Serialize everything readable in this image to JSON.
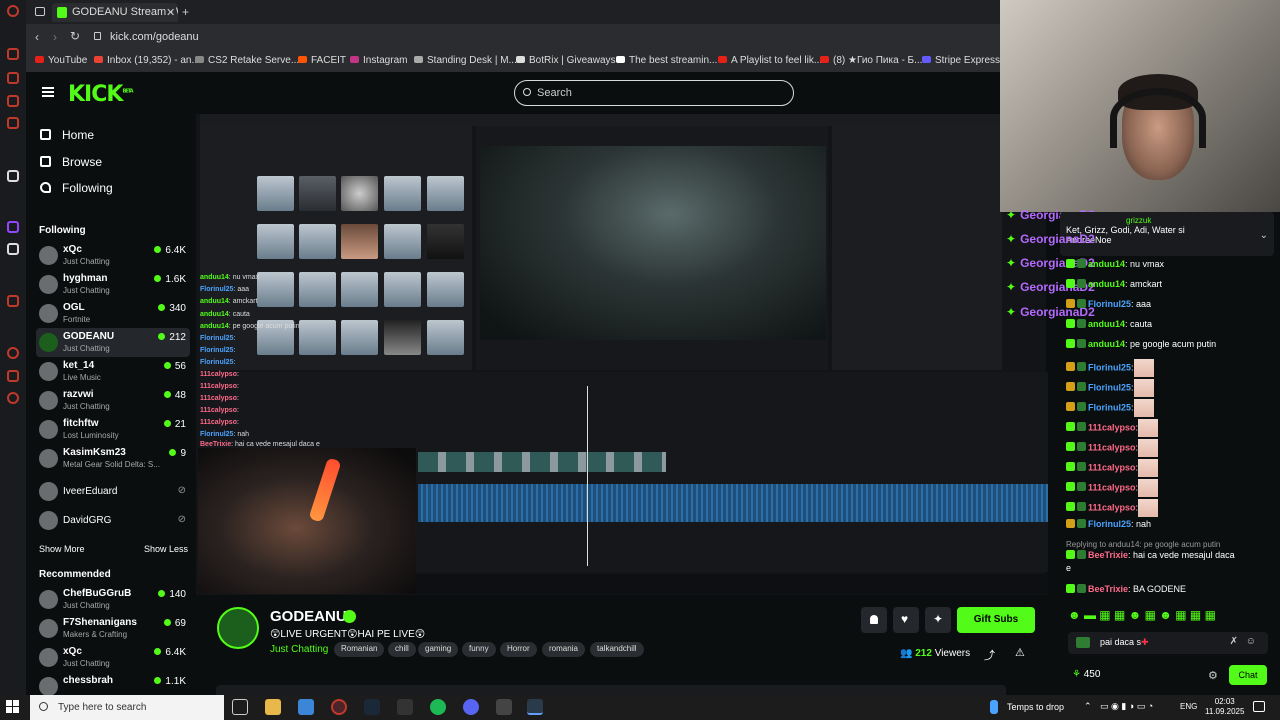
{
  "browser": {
    "tab_title": "GODEANU Stream - Watc",
    "url": "kick.com/godeanu",
    "bookmarks": [
      "YouTube",
      "Inbox (19,352) - an...",
      "CS2 Retake Serve...",
      "FACEIT",
      "Instagram",
      "Standing Desk | M...",
      "BotRix | Giveaways",
      "The best streamin...",
      "A Playlist to feel lik...",
      "(8) ★Гио Пика - Б...",
      "Stripe Express"
    ]
  },
  "header": {
    "logo": "KICK",
    "logo_beta": "BETA",
    "search_placeholder": "Search"
  },
  "nav": {
    "home": "Home",
    "browse": "Browse",
    "following": "Following"
  },
  "sidebar": {
    "following_title": "Following",
    "following": [
      {
        "name": "xQc",
        "sub": "Just Chatting",
        "count": "6.4K"
      },
      {
        "name": "hyghman",
        "sub": "Just Chatting",
        "count": "1.6K"
      },
      {
        "name": "OGL",
        "sub": "Fortnite",
        "count": "340"
      },
      {
        "name": "GODEANU",
        "sub": "Just Chatting",
        "count": "212"
      },
      {
        "name": "ket_14",
        "sub": "Live Music",
        "count": "56"
      },
      {
        "name": "razvwi",
        "sub": "Just Chatting",
        "count": "48"
      },
      {
        "name": "fitchftw",
        "sub": "Lost Luminosity",
        "count": "21"
      },
      {
        "name": "KasimKsm23",
        "sub": "Metal Gear Solid Delta: S...",
        "count": "9"
      },
      {
        "name": "IveerEduard",
        "sub": "",
        "count": ""
      },
      {
        "name": "DavidGRG",
        "sub": "",
        "count": ""
      }
    ],
    "show_more": "Show More",
    "show_less": "Show Less",
    "recommended_title": "Recommended",
    "recommended": [
      {
        "name": "ChefBuGGruB",
        "sub": "Just Chatting",
        "count": "140"
      },
      {
        "name": "F7Shenanigans",
        "sub": "Makers & Crafting",
        "count": "69"
      },
      {
        "name": "xQc",
        "sub": "Just Chatting",
        "count": "6.4K"
      },
      {
        "name": "chessbrah",
        "sub": "",
        "count": "1.1K"
      }
    ]
  },
  "video_chat": [
    {
      "user": "anduu14",
      "text": "nu vmax"
    },
    {
      "user": "Florinul25",
      "text": "aaa"
    },
    {
      "user": "anduu14",
      "text": "amckart"
    },
    {
      "user": "anduu14",
      "text": "cauta"
    },
    {
      "user": "anduu14",
      "text": "pe google acum putin"
    },
    {
      "user": "Florinul25",
      "text": ""
    },
    {
      "user": "Florinul25",
      "text": ""
    },
    {
      "user": "Florinul25",
      "text": ""
    },
    {
      "user": "111calypso",
      "text": ""
    },
    {
      "user": "111calypso",
      "text": ""
    },
    {
      "user": "111calypso",
      "text": ""
    },
    {
      "user": "111calypso",
      "text": ""
    },
    {
      "user": "111calypso",
      "text": ""
    },
    {
      "user": "Florinul25",
      "text": "nah"
    },
    {
      "user": "BeeTrixie",
      "text": "hai ca vede mesajul daca e"
    }
  ],
  "stream": {
    "name": "GODEANU",
    "title": "😲LIVE URGENT😲HAI PE LIVE😲",
    "category": "Just Chatting",
    "tags": [
      "Romanian",
      "chill",
      "gaming",
      "funny",
      "Horror",
      "romania",
      "talkandchill"
    ],
    "gift_subs": "Gift Subs",
    "viewers": "212",
    "viewers_label": "Viewers"
  },
  "chat": {
    "pinned_user": "GeorgianaD2",
    "pinned_user2": "grizzuk",
    "pinned_text": "Ket, Grizz, Godi, Adi, Water si",
    "pinned_text2": "AndreeNoe",
    "gifts": [
      "GeorgianaD2",
      "GeorgianaD2",
      "GeorgianaD2",
      "GeorgianaD2"
    ],
    "messages": [
      {
        "user": "anduu14",
        "color": "green",
        "text": ": nu vmax"
      },
      {
        "user": "anduu14",
        "color": "green",
        "text": ": amckart"
      },
      {
        "user": "Florinul25",
        "color": "blue",
        "text": ": aaa"
      },
      {
        "user": "anduu14",
        "color": "green",
        "text": ": cauta"
      },
      {
        "user": "anduu14",
        "color": "green",
        "text": ": pe google acum putin"
      },
      {
        "user": "Florinul25",
        "color": "blue",
        "text": ":"
      },
      {
        "user": "Florinul25",
        "color": "blue",
        "text": ":"
      },
      {
        "user": "Florinul25",
        "color": "blue",
        "text": ":"
      },
      {
        "user": "111calypso",
        "color": "pink",
        "text": ":"
      },
      {
        "user": "111calypso",
        "color": "pink",
        "text": ":"
      },
      {
        "user": "111calypso",
        "color": "pink",
        "text": ":"
      },
      {
        "user": "111calypso",
        "color": "pink",
        "text": ":"
      },
      {
        "user": "111calypso",
        "color": "pink",
        "text": ":"
      },
      {
        "user": "Florinul25",
        "color": "blue",
        "text": ": nah"
      }
    ],
    "reply_to": "Replying to anduu14: pe google acum putin",
    "reply_user": "BeeTrixie",
    "reply_text": ": hai ca vede mesajul daca",
    "reply_text2": "e",
    "last_user": "BeeTrixie",
    "last_text": ": BA GODENE",
    "input_value": "pai daca s",
    "points": "450",
    "send": "Chat"
  },
  "taskbar": {
    "search_placeholder": "Type here to search",
    "tray_text": "Temps to drop",
    "lang": "ENG",
    "time": "02:03",
    "date": "11.09.2025"
  },
  "colors": {
    "kick_green": "#53fc18",
    "bg": "#0b0e0f",
    "gift_purple": "#b469ff"
  }
}
